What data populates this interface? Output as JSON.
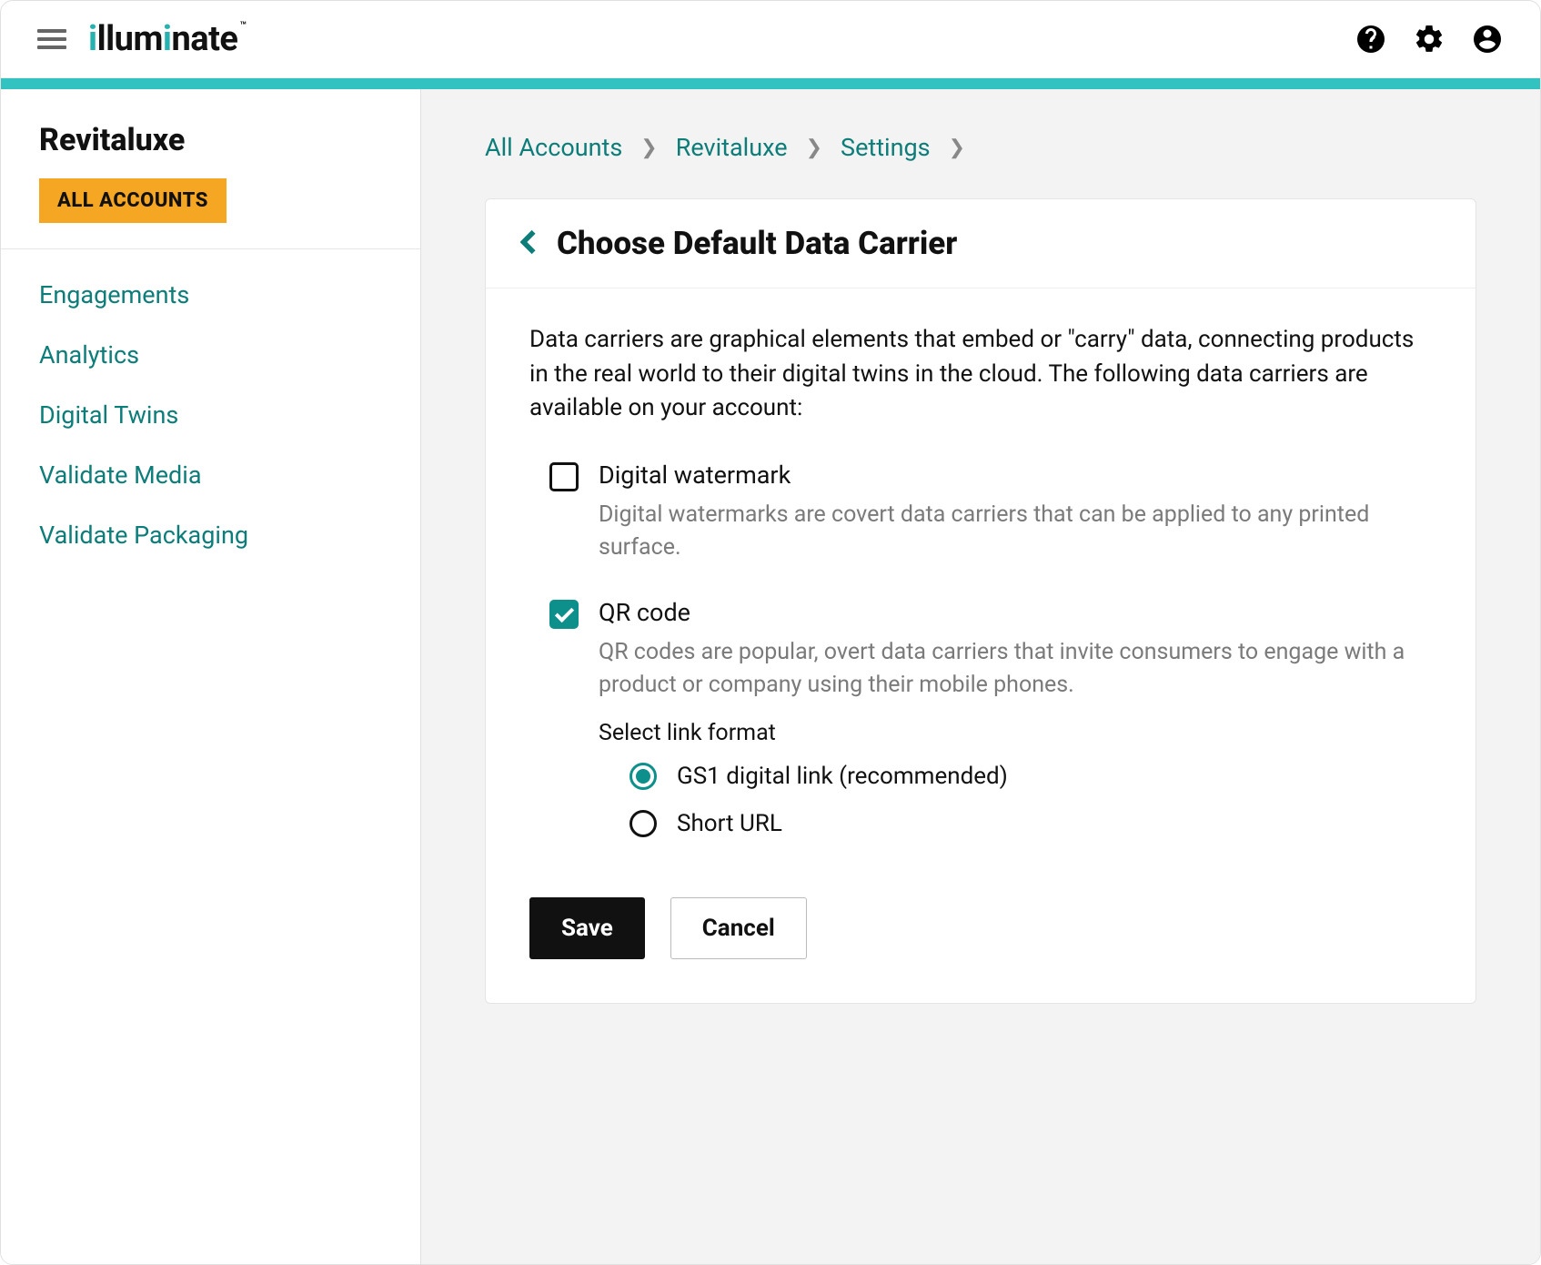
{
  "header": {
    "logo_text": "illuminate"
  },
  "sidebar": {
    "account_name": "Revitaluxe",
    "all_accounts_label": "ALL ACCOUNTS",
    "nav": [
      "Engagements",
      "Analytics",
      "Digital Twins",
      "Validate Media",
      "Validate Packaging"
    ]
  },
  "breadcrumb": {
    "items": [
      "All Accounts",
      "Revitaluxe",
      "Settings"
    ]
  },
  "card": {
    "title": "Choose Default Data Carrier",
    "intro": "Data carriers are graphical elements that embed or \"carry\" data, connecting products in the real world to their digital twins in the cloud. The following data carriers are available on your account:",
    "options": {
      "digital_watermark": {
        "label": "Digital watermark",
        "desc": "Digital watermarks are covert data carriers that can be applied to any printed surface.",
        "checked": false
      },
      "qr_code": {
        "label": "QR code",
        "desc": "QR codes are popular, overt data carriers that invite consumers to engage with a product or company using their mobile phones.",
        "checked": true,
        "link_format_label": "Select link format",
        "link_options": {
          "gs1": {
            "label": "GS1 digital link (recommended)",
            "selected": true
          },
          "short": {
            "label": "Short URL",
            "selected": false
          }
        }
      }
    },
    "actions": {
      "save": "Save",
      "cancel": "Cancel"
    }
  },
  "colors": {
    "teal": "#0d8f8c",
    "teal_light": "#32c3c0",
    "orange": "#f5a623"
  }
}
